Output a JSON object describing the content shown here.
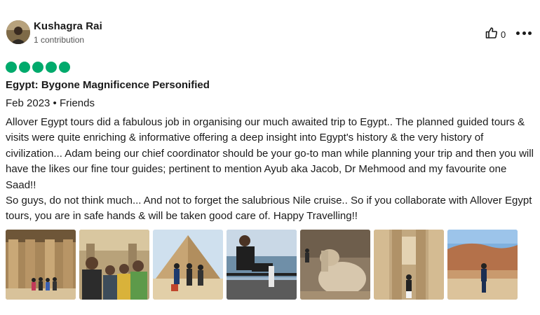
{
  "review": {
    "author": "Kushagra Rai",
    "contributions": "1 contribution",
    "helpful_count": "0",
    "rating_bubbles": 5,
    "rating_color": "#00aa6c",
    "title": "Egypt: Bygone Magnificence Personified",
    "trip_meta": "Feb 2023 • Friends",
    "body_paragraph_1": "Allover Egypt tours did a fabulous job in organising our much awaited trip to Egypt.. The planned guided tours & visits were quite enriching & informative offering a deep insight into Egypt's history & the very history of civilization... Adam being our chief coordinator should be your go-to man while planning your trip and then you will have the likes our fine tour guides; pertinent to mention Ayub aka Jacob, Dr Mehmood and my favourite one Saad!!",
    "body_paragraph_2": "So guys, do not think much... And not to forget the salubrious Nile cruise.. So if you collaborate with Allover Egypt tours, you are in safe hands & will be taken good care of. Happy Travelling!!"
  },
  "icons": {
    "helpful": "thumbs-up-icon",
    "more": "more-options-icon",
    "rating": "rating-bubble-icon"
  },
  "photos": [
    {
      "name": "photo-temple-columns-group"
    },
    {
      "name": "photo-temple-selfie"
    },
    {
      "name": "photo-pyramid-group"
    },
    {
      "name": "photo-nile-cruise-deck"
    },
    {
      "name": "photo-colossus-statue"
    },
    {
      "name": "photo-temple-pillars"
    },
    {
      "name": "photo-hatshepsut-temple"
    }
  ]
}
